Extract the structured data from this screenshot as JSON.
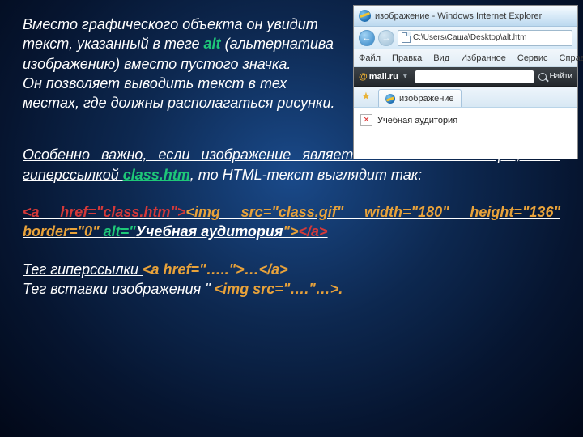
{
  "slide": {
    "para1_a": "Вместо графического объекта он увидит текст, указанный в теге ",
    "alt_word": "alt",
    "para1_b": " (альтернатива изображению) вместо пустого значка.",
    "para1_c": "Он позволяет выводить текст в тех местах, где должны располагаться рисунки.",
    "para2_a": "Особенно важно, если изображение является кнопкой навигации, т.е. гиперссылкой ",
    "para2_class": "class.htm",
    "para2_b": ", то HTML-текст выглядит так:",
    "code": {
      "a_open": "<a href=\"class.htm\">",
      "img_start": "<img src=\"class.gif\" width=\"180\" height=\"136\" border=\"0\" ",
      "alt_attr": "alt=\"",
      "alt_value": "Учебная аудитория",
      "img_end": "\">",
      "a_close": "</a>"
    },
    "tag_link_label": "Тег гиперссылки ",
    "tag_link_code": "<a href=\"…..\">…</a>",
    "tag_img_label": "Тег вставки изображения \"",
    "tag_img_code": "<img src=\"….\"…>."
  },
  "ie": {
    "title": "изображение - Windows Internet Explorer",
    "address": "C:\\Users\\Саша\\Desktop\\alt.htm",
    "menu": [
      "Файл",
      "Правка",
      "Вид",
      "Избранное",
      "Сервис",
      "Справка"
    ],
    "mailru": "@mail.ru",
    "find": "Найти",
    "tab_label": "изображение",
    "alt_text": "Учебная аудитория"
  }
}
